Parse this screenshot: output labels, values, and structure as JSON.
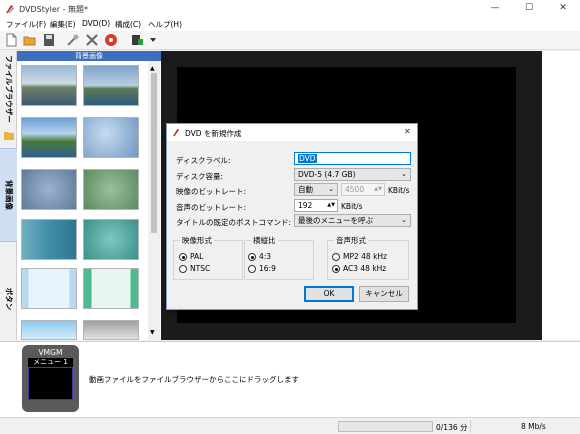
{
  "window": {
    "title": "DVDStyler - 無題*",
    "minimize_icon": "minimize-icon",
    "maximize_icon": "maximize-icon",
    "close_icon": "close-icon",
    "min_glyph": "—",
    "max_glyph": "☐",
    "close_glyph": "✕"
  },
  "menu": [
    "ファイル(F)",
    "編集(E)",
    "DVD(D)",
    "構成(C)",
    "ヘルプ(H)"
  ],
  "toolbar": {
    "icons": [
      "new-icon",
      "open-icon",
      "save-icon",
      "settings-icon",
      "tools-icon",
      "burn-icon",
      "add-file-icon",
      "dropdown-icon"
    ]
  },
  "tabs": [
    "ファイルブラウザー",
    "背景画像",
    "ボタン"
  ],
  "panel": {
    "header": "背景画像"
  },
  "vmgm": {
    "title": "VMGM",
    "menu_label": "メニュー 1"
  },
  "bottom": {
    "drag_hint": "動画ファイルをファイルブラウザーからここにドラッグします"
  },
  "status": {
    "progress_text": "0/136 分",
    "rate": "8 Mb/s",
    "progress_fraction": 0
  },
  "dialog": {
    "title": "DVD を新規作成",
    "disc_label_label": "ディスクラベル:",
    "disc_label_value": "DVD",
    "disc_capacity_label": "ディスク容量:",
    "disc_capacity_value": "DVD-5 (4.7 GB)",
    "video_bitrate_label": "映像のビットレート:",
    "video_bitrate_mode": "自動",
    "video_bitrate_value": "4500",
    "video_bitrate_unit": "KBit/s",
    "audio_bitrate_label": "音声のビットレート:",
    "audio_bitrate_value": "192",
    "audio_bitrate_unit": "KBit/s",
    "post_command_label": "タイトルの既定のポストコマンド:",
    "post_command_value": "最後のメニューを呼ぶ",
    "video_format": {
      "title": "映像形式",
      "options": [
        "PAL",
        "NTSC"
      ],
      "selected": 0
    },
    "aspect_ratio": {
      "title": "横縦比",
      "options": [
        "4:3",
        "16:9"
      ],
      "selected": 0
    },
    "audio_format": {
      "title": "音声形式",
      "options": [
        "MP2 48 kHz",
        "AC3 48 kHz"
      ],
      "selected": 1
    },
    "ok_label": "OK",
    "cancel_label": "キャンセル",
    "close_glyph": "✕"
  },
  "colors": {
    "accent": "#3c6fbf",
    "canvas": "#000000",
    "selection": "#0078d7"
  }
}
